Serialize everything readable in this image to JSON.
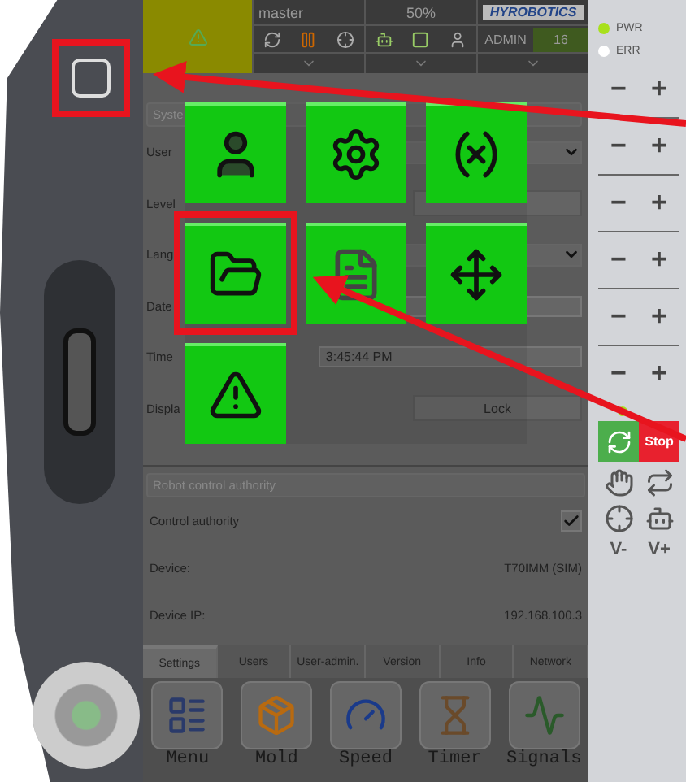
{
  "device": {
    "home_button": {
      "highlighted": true
    }
  },
  "status_bar": {
    "user": "master",
    "speed": "50%",
    "logo": "HYROBOTICS",
    "role": "ADMIN",
    "level": "16"
  },
  "system": {
    "title": "Syste",
    "rows": [
      {
        "kind": "dropdown",
        "label": "User"
      },
      {
        "kind": "button",
        "label": "Level"
      },
      {
        "kind": "dropdown",
        "label": "Lang"
      },
      {
        "kind": "field",
        "label": "Date"
      },
      {
        "kind": "field",
        "label": "Time",
        "value": "3:45:44 PM"
      },
      {
        "kind": "button",
        "label": "Displa",
        "button": "Lock"
      }
    ]
  },
  "popup": {
    "buttons": [
      {
        "kind": "user",
        "highlighted": false
      },
      {
        "kind": "settings",
        "highlighted": false
      },
      {
        "kind": "variable",
        "highlighted": false
      },
      {
        "kind": "folder",
        "highlighted": true
      },
      {
        "kind": "document",
        "highlighted": false
      },
      {
        "kind": "move",
        "highlighted": false
      },
      {
        "kind": "warning",
        "highlighted": false
      }
    ]
  },
  "authority": {
    "title": "Robot control authority",
    "control": {
      "label": "Control authority",
      "checked": true
    },
    "rows": [
      {
        "label": "Device:",
        "value": "T70IMM (SIM)"
      },
      {
        "label": "Device IP:",
        "value": "192.168.100.3"
      }
    ]
  },
  "tabs": [
    {
      "label": "Settings",
      "selected": true
    },
    {
      "label": "Users",
      "selected": false
    },
    {
      "label": "User-admin.",
      "selected": false
    },
    {
      "label": "Version",
      "selected": false
    },
    {
      "label": "Info",
      "selected": false
    },
    {
      "label": "Network",
      "selected": false
    }
  ],
  "apps": [
    {
      "kind": "menu",
      "label": "Menu"
    },
    {
      "kind": "mold",
      "label": "Mold"
    },
    {
      "kind": "speed",
      "label": "Speed"
    },
    {
      "kind": "timer",
      "label": "Timer"
    },
    {
      "kind": "signals",
      "label": "Signals"
    }
  ],
  "panel": {
    "leds": [
      {
        "label": "PWR",
        "on": true
      },
      {
        "label": "ERR",
        "on": false
      }
    ],
    "jog_rows": [
      {
        "minus": "−",
        "plus": "+"
      },
      {
        "minus": "−",
        "plus": "+"
      },
      {
        "minus": "−",
        "plus": "+"
      },
      {
        "minus": "−",
        "plus": "+"
      },
      {
        "minus": "−",
        "plus": "+"
      },
      {
        "minus": "−",
        "plus": "+"
      }
    ],
    "stop": "Stop",
    "speed_down": "V-",
    "speed_up": "V+"
  }
}
